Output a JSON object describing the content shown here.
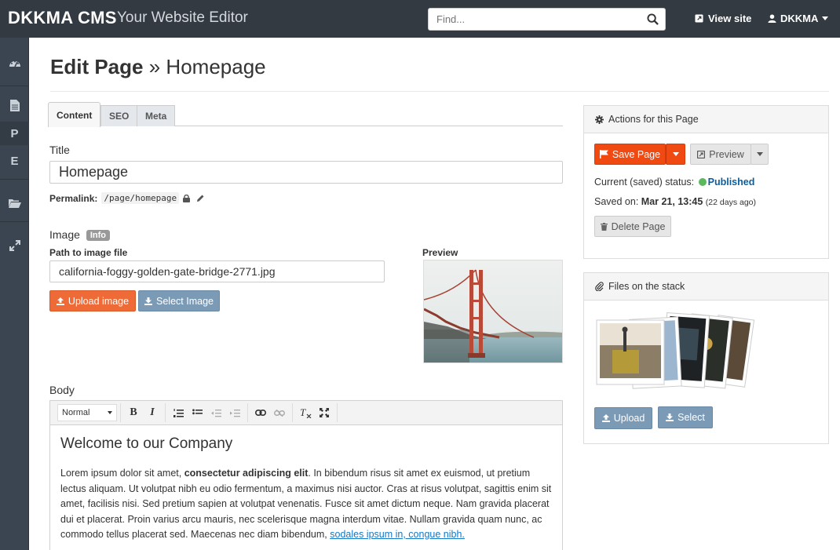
{
  "topbar": {
    "brand": "DKKMA CMS",
    "tagline": "Your Website Editor",
    "search_placeholder": "Find...",
    "view_site": "View site",
    "user": "DKKMA"
  },
  "sidebar": {
    "items": [
      {
        "icon": "dashboard-icon"
      },
      {
        "icon": "file-icon"
      },
      {
        "label": "P"
      },
      {
        "label": "E"
      },
      {
        "icon": "folder-icon"
      },
      {
        "icon": "expand-icon"
      }
    ]
  },
  "page": {
    "title_bold": "Edit Page",
    "title_sep": "»",
    "title_rest": "Homepage"
  },
  "tabs": [
    {
      "label": "Content",
      "active": true
    },
    {
      "label": "SEO",
      "active": false
    },
    {
      "label": "Meta",
      "active": false
    }
  ],
  "form": {
    "title_label": "Title",
    "title_value": "Homepage",
    "permalink_label": "Permalink:",
    "permalink_value": "/page/homepage",
    "image_label": "Image",
    "image_badge": "Info",
    "path_label": "Path to image file",
    "path_value": "california-foggy-golden-gate-bridge-2771.jpg",
    "preview_label": "Preview",
    "upload_image": "Upload image",
    "select_image": "Select Image",
    "body_label": "Body"
  },
  "editor": {
    "format_select": "Normal",
    "heading": "Welcome to our Company",
    "p_start": "Lorem ipsum dolor sit amet, ",
    "p_bold": "consectetur adipiscing elit",
    "p_mid": ". In bibendum risus sit amet ex euismod, ut pretium lectus aliquam. Ut volutpat nibh eu odio fermentum, a maximus nisi auctor. Cras at risus volutpat, sagittis enim sit amet, facilisis nisi. Sed pretium sapien at volutpat venenatis. Fusce sit amet dictum neque. Nam gravida placerat dui et placerat. Proin varius arcu mauris, nec scelerisque magna interdum vitae. Nullam gravida quam nunc, ac commodo tellus placerat sed. Maecenas nec diam bibendum, ",
    "p_link": "sodales ipsum in, congue nibh."
  },
  "actions": {
    "heading": "Actions for this Page",
    "save": "Save Page",
    "preview": "Preview",
    "status_label": "Current (saved) status:",
    "status_value": "Published",
    "saved_label": "Saved on:",
    "saved_date": "Mar 21, 13:45",
    "saved_ago": "(22 days ago)",
    "delete": "Delete Page"
  },
  "files": {
    "heading": "Files on the stack",
    "upload": "Upload",
    "select": "Select"
  },
  "colors": {
    "topbar": "#333a42",
    "sidebar": "#3b4551",
    "save": "#f04912",
    "upload_image": "#ee6a37",
    "secondary": "#7b9ab6",
    "published": "#0c5d9c"
  }
}
